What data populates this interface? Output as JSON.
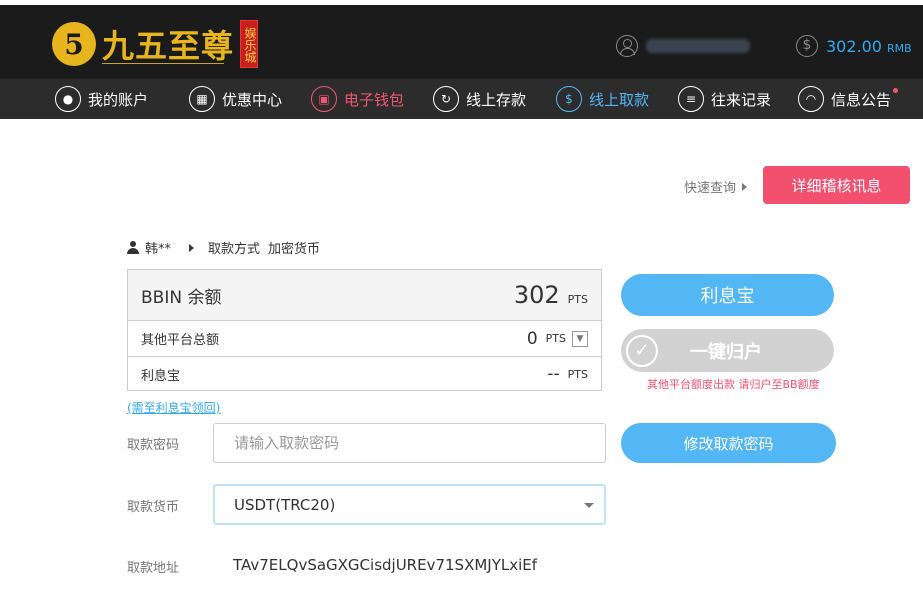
{
  "header": {
    "logo_mark": "5",
    "logo_name": "九五至尊",
    "logo_badge": "娱乐城",
    "balance_value": "302.00",
    "balance_unit": "RMB"
  },
  "nav": {
    "items": [
      {
        "label": "我的账户",
        "icon": "user-icon"
      },
      {
        "label": "优惠中心",
        "icon": "gift-icon"
      },
      {
        "label": "电子钱包",
        "icon": "wallet-icon"
      },
      {
        "label": "线上存款",
        "icon": "deposit-icon"
      },
      {
        "label": "线上取款",
        "icon": "withdraw-icon"
      },
      {
        "label": "往来记录",
        "icon": "records-icon"
      },
      {
        "label": "信息公告",
        "icon": "bell-icon"
      }
    ]
  },
  "quick_query": "快速查询",
  "detail_button": "详细稽核讯息",
  "breadcrumb": {
    "user": "韩**",
    "method_label": "取款方式",
    "method_value": "加密货币"
  },
  "balance_box": {
    "main_label": "BBIN 余额",
    "main_amount": "302",
    "unit": "PTS",
    "other_label": "其他平台总额",
    "other_amount": "0",
    "interest_label": "利息宝",
    "interest_amount": "--"
  },
  "interest_link": "(需至利息宝领回)",
  "buttons": {
    "interest": "利息宝",
    "collect_all": "一键归户",
    "change_password": "修改取款密码"
  },
  "collect_note": "其他平台额度出款 请归户至BB额度",
  "form": {
    "password_label": "取款密码",
    "password_placeholder": "请输入取款密码",
    "currency_label": "取款货币",
    "currency_value": "USDT(TRC20)",
    "address_label": "取款地址",
    "address_value": "TAv7ELQvSaGXGCisdjUREv71SXMJYLxiEf"
  },
  "colors": {
    "accent_blue": "#53b6f5",
    "accent_pink": "#f2506e",
    "gold": "#e9b51f"
  }
}
